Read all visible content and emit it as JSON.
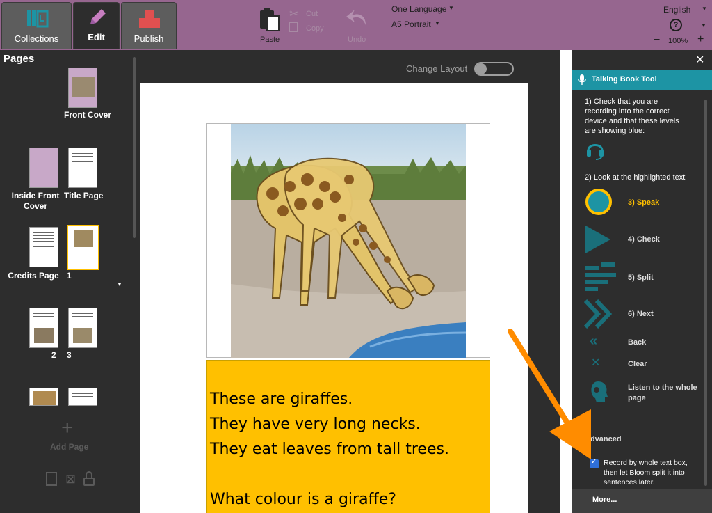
{
  "tabs": {
    "collections": "Collections",
    "edit": "Edit",
    "publish": "Publish"
  },
  "toolbar": {
    "paste": "Paste",
    "cut": "Cut",
    "copy": "Copy",
    "undo": "Undo",
    "language_mode": "One Language",
    "page_size": "A5 Portrait",
    "ui_language": "English",
    "help": "?",
    "zoom": "100%",
    "zoom_minus": "−",
    "zoom_plus": "+"
  },
  "pages_panel": {
    "title": "Pages",
    "pages": [
      {
        "label": "Front Cover"
      },
      {
        "label": "Inside Front Cover"
      },
      {
        "label": "Title Page"
      },
      {
        "label": "Credits Page"
      },
      {
        "label": "1"
      },
      {
        "label": "2"
      },
      {
        "label": "3"
      }
    ],
    "add_page": "Add Page"
  },
  "canvas": {
    "change_layout": "Change Layout",
    "story_lines": [
      "These are giraffes.",
      "They have very long necks.",
      "They eat leaves from tall trees.",
      "What colour is a giraffe?"
    ]
  },
  "talking_book_tool": {
    "title": "Talking Book Tool",
    "instruction_1": "1) Check that you are recording into the correct device and that these levels are showing blue:",
    "instruction_2": "2) Look at the highlighted text",
    "steps": {
      "speak": "3) Speak",
      "check": "4) Check",
      "split": "5) Split",
      "next": "6) Next",
      "back": "Back",
      "clear": "Clear",
      "listen": "Listen to the whole page"
    },
    "advanced": "Advanced",
    "record_option": "Record by whole text box, then let Bloom split it into sentences later.",
    "more": "More...",
    "close": "✕"
  },
  "colors": {
    "topbar": "#96668f",
    "tool_header": "#1d94a4",
    "speak_highlight": "#ffc000",
    "text_box": "#ffc000",
    "arrow": "#ff8c00"
  }
}
